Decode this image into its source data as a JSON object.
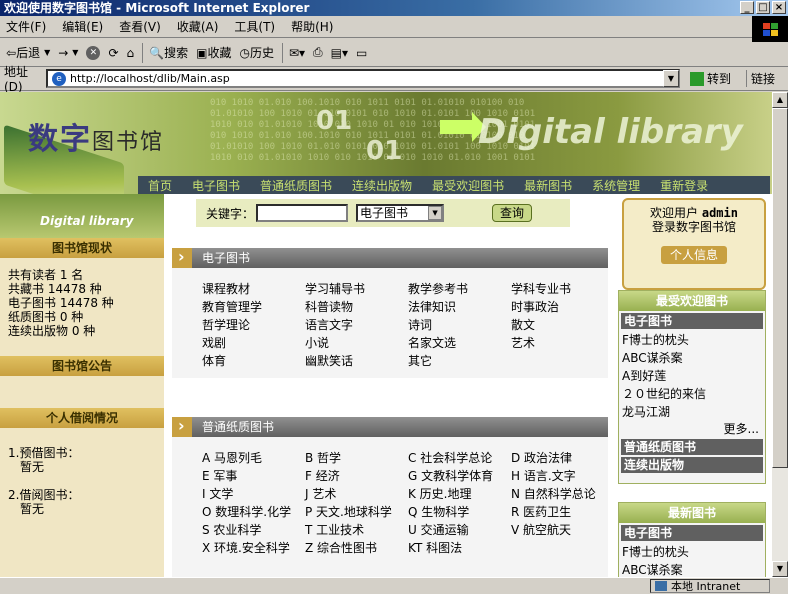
{
  "window": {
    "title": "欢迎使用数字图书馆 - Microsoft Internet Explorer",
    "min": "_",
    "max": "□",
    "close": "×"
  },
  "menu": [
    "文件(F)",
    "编辑(E)",
    "查看(V)",
    "收藏(A)",
    "工具(T)",
    "帮助(H)"
  ],
  "toolbar": {
    "back": "后退",
    "forward": "→",
    "search": "搜索",
    "favorites": "收藏",
    "history": "历史"
  },
  "address": {
    "label": "地址(D)",
    "url": "http://localhost/dlib/Main.asp",
    "go": "转到",
    "links": "链接"
  },
  "status": {
    "zone": "本地 Intranet"
  },
  "banner": {
    "logo_cn_a": "数字",
    "logo_cn_b": "图书馆",
    "logo_en": "Digital library",
    "badge": "Digital library",
    "num_a": "01",
    "num_b": "01",
    "nav": [
      "首页",
      "电子图书",
      "普通纸质图书",
      "连续出版物",
      "最受欢迎图书",
      "最新图书",
      "系统管理",
      "重新登录"
    ]
  },
  "left": {
    "status_title": "图书馆现状",
    "stats": [
      "共有读者 1 名",
      "共藏书 14478 种",
      "电子图书 14478 种",
      "纸质图书 0 种",
      "连续出版物 0 种"
    ],
    "notice_title": "图书馆公告",
    "borrow_title": "个人借阅情况",
    "reserve_label": "1.预借图书：",
    "reserve_value": "暂无",
    "borrowed_label": "2.借阅图书：",
    "borrowed_value": "暂无"
  },
  "search": {
    "label": "关键字：",
    "select_value": "电子图书",
    "button": "查询"
  },
  "ebooks": {
    "title": "电子图书",
    "items": [
      "课程教材",
      "学习辅导书",
      "教学参考书",
      "学科专业书",
      "教育管理学",
      "科普读物",
      "法律知识",
      "时事政治",
      "哲学理论",
      "语言文字",
      "诗词",
      "散文",
      "戏剧",
      "小说",
      "名家文选",
      "艺术",
      "体育",
      "幽默笑话",
      "其它"
    ]
  },
  "paperbooks": {
    "title": "普通纸质图书",
    "items": [
      "A 马恩列毛",
      "B 哲学",
      "C 社会科学总论",
      "D 政治法律",
      "E 军事",
      "F 经济",
      "G 文教科学体育",
      "H 语言.文字",
      "I 文学",
      "J 艺术",
      "K 历史.地理",
      "N 自然科学总论",
      "O 数理科学.化学",
      "P 天文.地球科学",
      "Q 生物科学",
      "R 医药卫生",
      "S 农业科学",
      "T 工业技术",
      "U 交通运输",
      "V 航空航天",
      "X 环境.安全科学",
      "Z 综合性图书",
      "KT 科图法"
    ]
  },
  "user": {
    "welcome": "欢迎用户",
    "name": "admin",
    "line2": "登录数字图书馆",
    "button": "个人信息"
  },
  "popular": {
    "title": "最受欢迎图书",
    "ebook_head": "电子图书",
    "items": [
      "F博士的枕头",
      "ABC谋杀案",
      "A到好莲",
      "２０世纪的来信",
      "龙马江湖"
    ],
    "more": "更多...",
    "paper_head": "普通纸质图书",
    "serial_head": "连续出版物"
  },
  "newest": {
    "title": "最新图书",
    "ebook_head": "电子图书",
    "items": [
      "F博士的枕头",
      "ABC谋杀案"
    ]
  }
}
